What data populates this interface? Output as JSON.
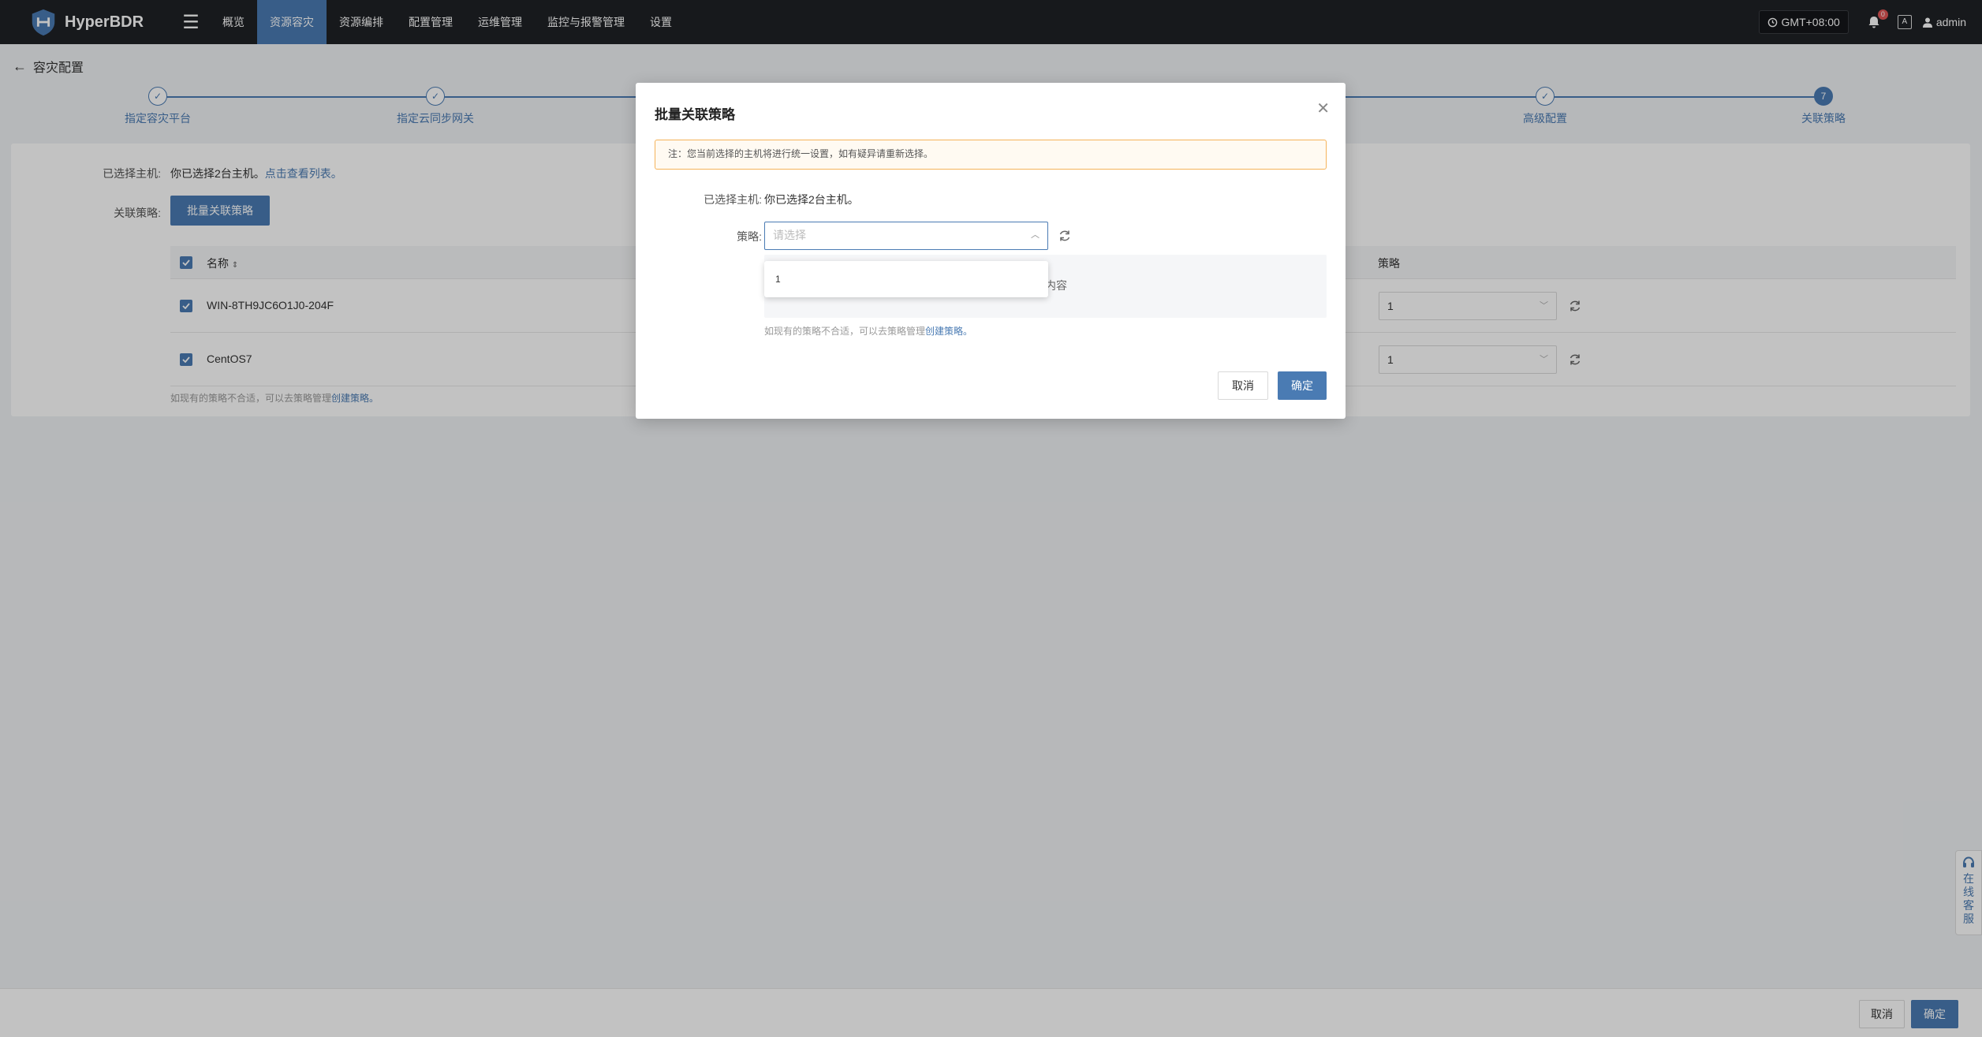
{
  "topnav": {
    "brand": "HyperBDR",
    "items": [
      "概览",
      "资源容灾",
      "资源编排",
      "配置管理",
      "运维管理",
      "监控与报警管理",
      "设置"
    ],
    "active_index": 1,
    "timezone": "GMT+08:00",
    "notification_count": "0",
    "language_icon": "A",
    "user": "admin"
  },
  "page": {
    "title": "容灾配置",
    "steps": [
      {
        "label": "指定容灾平台",
        "state": "done"
      },
      {
        "label": "指定云同步网关",
        "state": "done"
      },
      {
        "label": "高级配置",
        "state": "done"
      },
      {
        "label": "关联策略",
        "state": "current",
        "number": "7"
      }
    ],
    "selected_hosts_label": "已选择主机:",
    "selected_hosts_text": "你已选择2台主机。",
    "view_list_link": "点击查看列表。",
    "policy_label": "关联策略:",
    "batch_button": "批量关联策略",
    "table": {
      "col_name": "名称",
      "col_policy": "策略",
      "rows": [
        {
          "name": "WIN-8TH9JC6O1J0-204F",
          "policy": "1"
        },
        {
          "name": "CentOS7",
          "policy": "1"
        }
      ]
    },
    "hint_text": "如现有的策略不合适，可以去策略管理",
    "hint_link": "创建策略。"
  },
  "footer": {
    "cancel": "取消",
    "confirm": "确定"
  },
  "chat_tab": [
    "在",
    "线",
    "客",
    "服"
  ],
  "modal": {
    "title": "批量关联策略",
    "notice": "注：您当前选择的主机将进行统一设置，如有疑异请重新选择。",
    "selected_label": "已选择主机:",
    "selected_text": "你已选择2台主机。",
    "policy_label": "策略:",
    "policy_placeholder": "请选择",
    "dropdown_options": [
      "1"
    ],
    "empty_text_visible": "内容",
    "hint_text": "如现有的策略不合适，可以去策略管理",
    "hint_link": "创建策略。",
    "cancel": "取消",
    "confirm": "确定"
  },
  "colors": {
    "primary": "#4a7bb3",
    "nav_bg": "#1f2125",
    "notice_border": "#f5b35a",
    "badge": "#e05555"
  }
}
